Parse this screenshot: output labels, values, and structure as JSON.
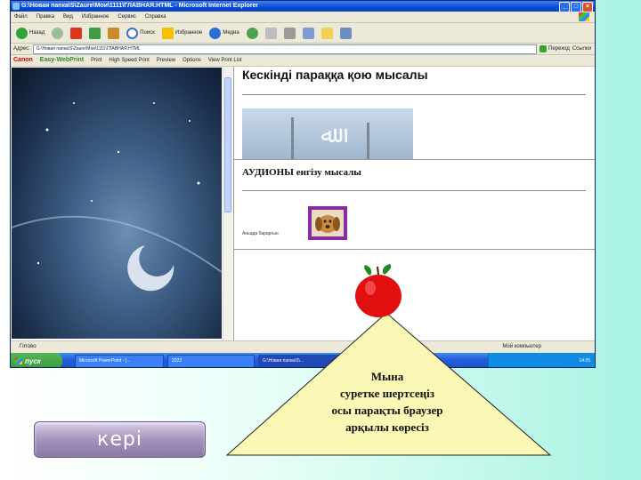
{
  "window": {
    "title": "G:\\Новая папка\\S\\Zaure\\Мои\\1111\\ГЛАВНАЯ.HTML - Microsoft Internet Explorer",
    "menu": [
      "Файл",
      "Правка",
      "Вид",
      "Избранное",
      "Сервис",
      "Справка"
    ],
    "toolbar": {
      "back": "Назад",
      "search": "Поиск",
      "favorites": "Избранное",
      "media": "Медиа"
    },
    "address_label": "Адрес:",
    "address_value": "G:\\Новая папка\\S\\Zaure\\Мои\\1111\\ГЛАВНАЯ.HTML",
    "go_label": "Переход",
    "links_label": "Ссылки",
    "canon_bar": {
      "brand": "Canon",
      "product": "Easy-WebPrint",
      "print": "Print",
      "hs_print": "High Speed Print",
      "preview": "Preview",
      "options": "Options",
      "view_list": "View Print List"
    },
    "status_left": "Готово",
    "status_right": "Мой компьютер"
  },
  "content": {
    "heading1": "Кескінді параққа қою мысалы",
    "heading2": "АУДИОНЫ енгізу мысалы",
    "audio_caption": "Аньада бараргын"
  },
  "taskbar": {
    "start": "пуск",
    "tasks": [
      "Microsoft PowerPoint - [...",
      "2222",
      "G:\\Новая папка\\S\\..."
    ],
    "clock": "14:25"
  },
  "back_button": "кері",
  "tooltip_lines": [
    "Мына",
    "суретке шертсеңіз",
    "осы парақты браузер",
    "арқылы көресіз"
  ],
  "colors": {
    "accent": "#0a4bd6",
    "triangle_fill": "#fbf7b5",
    "apple": "#e01010"
  }
}
